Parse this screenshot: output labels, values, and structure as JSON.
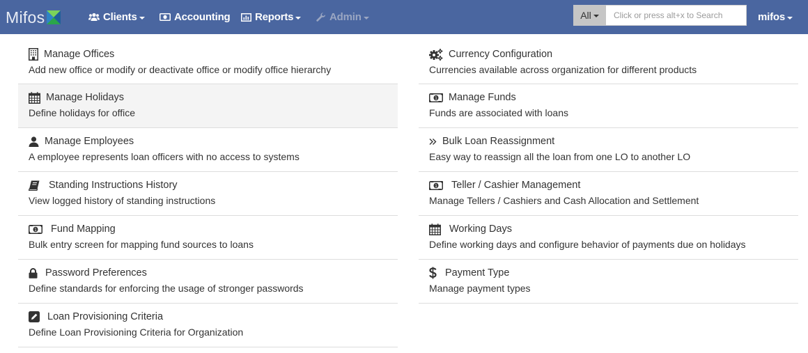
{
  "navbar": {
    "brand": "Mifos",
    "items": [
      {
        "label": "Clients",
        "icon": "users-icon",
        "dropdown": true,
        "disabled": false
      },
      {
        "label": "Accounting",
        "icon": "money-icon",
        "dropdown": false,
        "disabled": false
      },
      {
        "label": "Reports",
        "icon": "bar-chart-icon",
        "dropdown": true,
        "disabled": false
      },
      {
        "label": "Admin",
        "icon": "wrench-icon",
        "dropdown": true,
        "disabled": true
      }
    ],
    "search": {
      "scope": "All",
      "placeholder": "Click or press alt+x to Search",
      "value": ""
    },
    "user": "mifos",
    "colors": {
      "background": "#4a66a0",
      "disabled_text": "#9aa6c2"
    }
  },
  "left_column": [
    {
      "title": "Manage Offices",
      "description": "Add new office or modify or deactivate office or modify office hierarchy",
      "icon": "building-icon",
      "highlighted": false
    },
    {
      "title": "Manage Holidays",
      "description": "Define holidays for office",
      "icon": "calendar-icon",
      "highlighted": true
    },
    {
      "title": "Manage Employees",
      "description": "A employee represents loan officers with no access to systems",
      "icon": "user-icon",
      "highlighted": false
    },
    {
      "title": "Standing Instructions History",
      "description": "View logged history of standing instructions",
      "icon": "book-icon",
      "highlighted": false
    },
    {
      "title": "Fund Mapping",
      "description": "Bulk entry screen for mapping fund sources to loans",
      "icon": "money-icon",
      "highlighted": false
    },
    {
      "title": "Password Preferences",
      "description": "Define standards for enforcing the usage of stronger passwords",
      "icon": "lock-icon",
      "highlighted": false
    },
    {
      "title": "Loan Provisioning Criteria",
      "description": "Define Loan Provisioning Criteria for Organization",
      "icon": "edit-icon",
      "highlighted": false
    }
  ],
  "right_column": [
    {
      "title": "Currency Configuration",
      "description": "Currencies available across organization for different products",
      "icon": "cogs-icon"
    },
    {
      "title": "Manage Funds",
      "description": "Funds are associated with loans",
      "icon": "money-icon"
    },
    {
      "title": "Bulk Loan Reassignment",
      "description": "Easy way to reassign all the loan from one LO to another LO",
      "icon": "double-angle-right-icon"
    },
    {
      "title": "Teller / Cashier Management",
      "description": "Manage Tellers / Cashiers and Cash Allocation and Settlement",
      "icon": "money-icon"
    },
    {
      "title": "Working Days",
      "description": "Define working days and configure behavior of payments due on holidays",
      "icon": "calendar-icon"
    },
    {
      "title": "Payment Type",
      "description": "Manage payment types",
      "icon": "dollar-icon"
    }
  ]
}
